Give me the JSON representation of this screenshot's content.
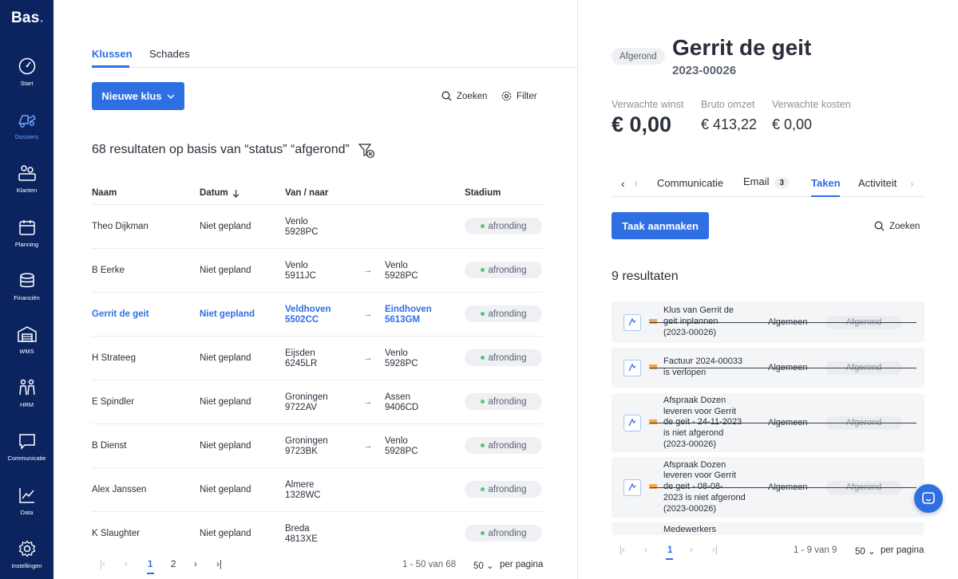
{
  "brand": {
    "name": "Bas",
    "dot": "."
  },
  "nav": [
    {
      "id": "start",
      "label": "Start",
      "icon": "gauge-icon"
    },
    {
      "id": "dossiers",
      "label": "Dossiers",
      "icon": "truck-icon",
      "active": true
    },
    {
      "id": "klanten",
      "label": "Klanten",
      "icon": "customers-icon"
    },
    {
      "id": "planning",
      "label": "Planning",
      "icon": "calendar-icon"
    },
    {
      "id": "financien",
      "label": "Financiën",
      "icon": "coins-icon"
    },
    {
      "id": "wms",
      "label": "WMS",
      "icon": "warehouse-icon"
    },
    {
      "id": "hrm",
      "label": "HRM",
      "icon": "people-icon"
    },
    {
      "id": "communicatie",
      "label": "Communicatie",
      "icon": "chat-bubble-icon"
    },
    {
      "id": "data",
      "label": "Data",
      "icon": "line-chart-icon"
    },
    {
      "id": "instellingen",
      "label": "Instellingen",
      "icon": "gear-icon"
    }
  ],
  "left": {
    "tabs": [
      {
        "label": "Klussen",
        "active": true
      },
      {
        "label": "Schades"
      }
    ],
    "new_button": "Nieuwe klus",
    "search_label": "Zoeken",
    "filter_label": "Filter",
    "results_headline": "68 resultaten op basis van “status” “afgerond”",
    "columns": {
      "name": "Naam",
      "date": "Datum",
      "route": "Van / naar",
      "stage": "Stadium"
    },
    "rows": [
      {
        "name": "Theo Dijkman",
        "date": "Niet gepland",
        "from_city": "Venlo",
        "from_zip": "5928PC",
        "to_city": "",
        "to_zip": "",
        "stage": "afronding"
      },
      {
        "name": "B Eerke",
        "date": "Niet gepland",
        "from_city": "Venlo",
        "from_zip": "5911JC",
        "to_city": "Venlo",
        "to_zip": "5928PC",
        "stage": "afronding"
      },
      {
        "name": "Gerrit de geit",
        "date": "Niet gepland",
        "from_city": "Veldhoven",
        "from_zip": "5502CC",
        "to_city": "Eindhoven",
        "to_zip": "5613GM",
        "stage": "afronding",
        "selected": true
      },
      {
        "name": "H Strateeg",
        "date": "Niet gepland",
        "from_city": "Eijsden",
        "from_zip": "6245LR",
        "to_city": "Venlo",
        "to_zip": "5928PC",
        "stage": "afronding"
      },
      {
        "name": "E Spindler",
        "date": "Niet gepland",
        "from_city": "Groningen",
        "from_zip": "9722AV",
        "to_city": "Assen",
        "to_zip": "9406CD",
        "stage": "afronding"
      },
      {
        "name": "B Dienst",
        "date": "Niet gepland",
        "from_city": "Groningen",
        "from_zip": "9723BK",
        "to_city": "Venlo",
        "to_zip": "5928PC",
        "stage": "afronding"
      },
      {
        "name": "Alex Janssen",
        "date": "Niet gepland",
        "from_city": "Almere",
        "from_zip": "1328WC",
        "to_city": "",
        "to_zip": "",
        "stage": "afronding"
      },
      {
        "name": "K Slaughter",
        "date": "Niet gepland",
        "from_city": "Breda",
        "from_zip": "4813XE",
        "to_city": "",
        "to_zip": "",
        "stage": "afronding"
      }
    ],
    "pagination": {
      "pages": [
        "1",
        "2"
      ],
      "current": "1",
      "range": "1 - 50 van 68",
      "per_page": "50",
      "per_page_label": "per pagina"
    }
  },
  "right": {
    "status": "Afgerond",
    "title": "Gerrit de geit",
    "number": "2023-00026",
    "kpis": [
      {
        "label": "Verwachte winst",
        "value": "€ 0,00"
      },
      {
        "label": "Bruto omzet",
        "value": "€ 413,22"
      },
      {
        "label": "Verwachte kosten",
        "value": "€ 0,00"
      }
    ],
    "tabs": [
      {
        "label": "Communicatie"
      },
      {
        "label": "Email",
        "count": "3"
      },
      {
        "label": "Taken",
        "active": true
      },
      {
        "label": "Activiteit"
      }
    ],
    "create_task": "Taak aanmaken",
    "search_label": "Zoeken",
    "results": "9 resultaten",
    "tasks": [
      {
        "lines": [
          "Klus van Gerrit de",
          "geit inplannen",
          "(2023-00026)"
        ],
        "category": "Algemeen",
        "status": "Afgerond"
      },
      {
        "lines": [
          "Factuur 2024-00033",
          "is verlopen"
        ],
        "category": "Algemeen",
        "status": "Afgerond"
      },
      {
        "lines": [
          "Afspraak Dozen",
          "leveren voor Gerrit",
          "de geit - 24-11-2023",
          "is niet afgerond",
          "(2023-00026)"
        ],
        "category": "Algemeen",
        "status": "Afgerond"
      },
      {
        "lines": [
          "Afspraak Dozen",
          "leveren voor Gerrit",
          "de geit - 08-08-",
          "2023 is niet afgerond",
          "(2023-00026)"
        ],
        "category": "Algemeen",
        "status": "Afgerond"
      },
      {
        "lines": [
          "Medewerkers"
        ],
        "category": "",
        "status": ""
      }
    ],
    "pagination": {
      "current": "1",
      "range": "1 - 9 van 9",
      "per_page": "50",
      "per_page_label": "per pagina"
    }
  }
}
